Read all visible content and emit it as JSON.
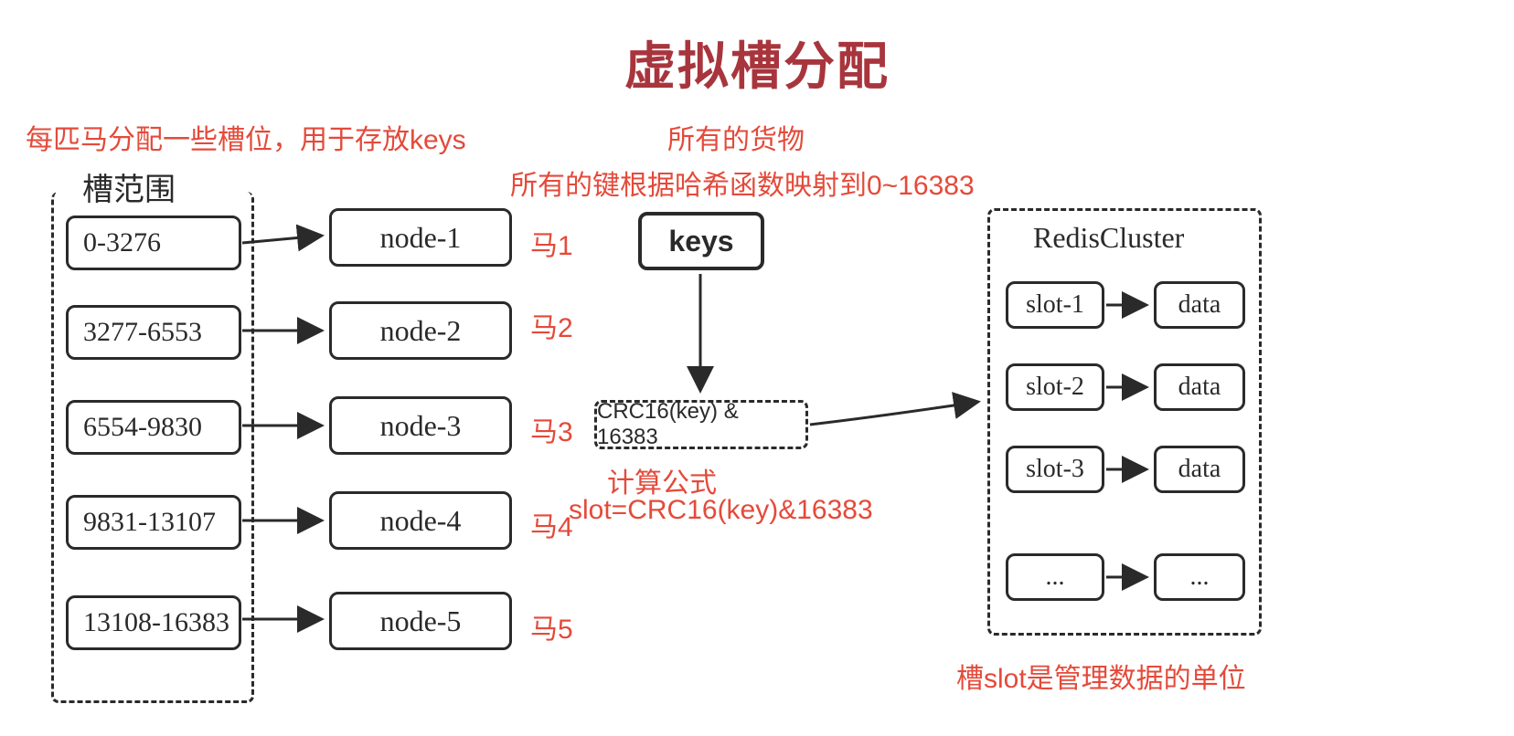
{
  "title": "虚拟槽分配",
  "labels": {
    "horse_alloc": "每匹马分配一些槽位，用于存放keys",
    "all_goods": "所有的货物",
    "hash_map": "所有的键根据哈希函数映射到0~16383",
    "slot_unit": "槽slot是管理数据的单位",
    "slot_range_title": "槽范围",
    "cluster_title": "RedisCluster",
    "formula_l1": "计算公式",
    "formula_l2": "slot=CRC16(key)&16383"
  },
  "slot_ranges": [
    {
      "range": "0-3276",
      "node": "node-1",
      "horse": "马1"
    },
    {
      "range": "3277-6553",
      "node": "node-2",
      "horse": "马2"
    },
    {
      "range": "6554-9830",
      "node": "node-3",
      "horse": "马3"
    },
    {
      "range": "9831-13107",
      "node": "node-4",
      "horse": "马4"
    },
    {
      "range": "13108-16383",
      "node": "node-5",
      "horse": "马5"
    }
  ],
  "keys_label": "keys",
  "crc_label": "CRC16(key) & 16383",
  "cluster_rows": [
    {
      "slot": "slot-1",
      "data": "data"
    },
    {
      "slot": "slot-2",
      "data": "data"
    },
    {
      "slot": "slot-3",
      "data": "data"
    },
    {
      "slot": "...",
      "data": "..."
    }
  ]
}
